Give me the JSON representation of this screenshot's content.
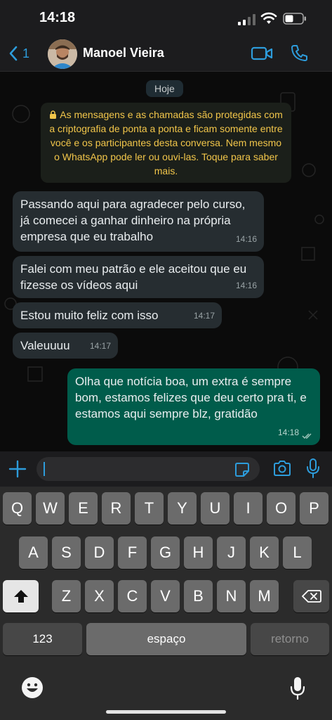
{
  "status_bar": {
    "time": "14:18"
  },
  "header": {
    "back_count": "1",
    "contact_name": "Manoel Vieira"
  },
  "chat": {
    "date_label": "Hoje",
    "encryption_notice": "As mensagens e as chamadas são protegidas com a criptografia de ponta a ponta e ficam somente entre você e os participantes desta conversa. Nem mesmo o WhatsApp pode ler ou ouvi-las. Toque para saber mais.",
    "messages": [
      {
        "direction": "in",
        "text": "Passando aqui para agradecer pelo curso, já comecei a ganhar dinheiro na própria empresa que eu trabalho",
        "time": "14:16"
      },
      {
        "direction": "in",
        "text": "Falei com meu patrão e ele aceitou que eu fizesse os vídeos aqui",
        "time": "14:16"
      },
      {
        "direction": "in",
        "text": "Estou muito feliz com isso",
        "time": "14:17"
      },
      {
        "direction": "in",
        "text": "Valeuuuu",
        "time": "14:17"
      },
      {
        "direction": "out",
        "text": "Olha que notícia boa, um extra é sempre bom, estamos felizes que deu certo pra ti, e estamos aqui sempre blz, gratidão",
        "time": "14:18"
      }
    ]
  },
  "input": {
    "value": "",
    "placeholder": ""
  },
  "keyboard": {
    "row1": [
      "Q",
      "W",
      "E",
      "R",
      "T",
      "Y",
      "U",
      "I",
      "O",
      "P"
    ],
    "row2": [
      "A",
      "S",
      "D",
      "F",
      "G",
      "H",
      "J",
      "K",
      "L"
    ],
    "row3": [
      "Z",
      "X",
      "C",
      "V",
      "B",
      "N",
      "M"
    ],
    "numbers_key": "123",
    "space_key": "espaço",
    "return_key": "retorno"
  },
  "colors": {
    "accent": "#2d9cdb",
    "outgoing_bubble": "#005c4b",
    "incoming_bubble": "#262d31",
    "notice_text": "#f2c64a"
  }
}
